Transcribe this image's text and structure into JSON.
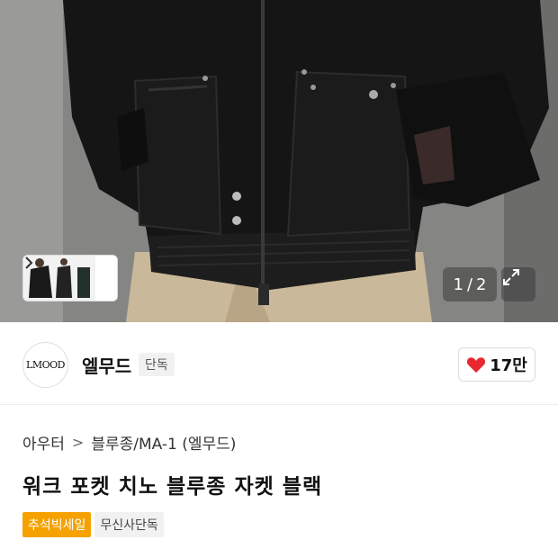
{
  "gallery": {
    "current": "1",
    "separator": "/",
    "total": "2",
    "thumb_next_icon": "chevron-right-icon",
    "expand_icon": "expand-icon"
  },
  "brand": {
    "logo_text": "LMOOD",
    "name": "엘무드",
    "tag": "단독",
    "like_count": "17만",
    "like_color": "#e8272f"
  },
  "breadcrumb": {
    "items": [
      "아우터",
      "블루종/MA-1 (엘무드)"
    ],
    "separator": ">"
  },
  "product": {
    "title": "워크 포켓 치노 블루종 자켓 블랙"
  },
  "tags": [
    {
      "label": "추석빅세일",
      "color": "#f5a200"
    },
    {
      "label": "무신사단독"
    }
  ]
}
